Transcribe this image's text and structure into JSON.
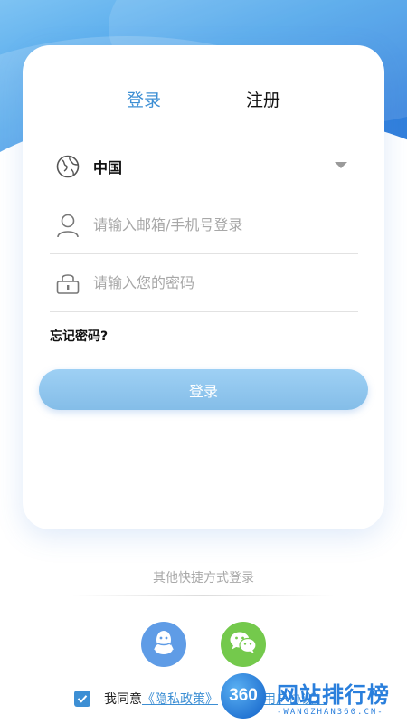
{
  "tabs": {
    "login": "登录",
    "register": "注册"
  },
  "country": {
    "value": "中国",
    "icon": "globe-icon"
  },
  "account": {
    "placeholder": "请输入邮箱/手机号登录",
    "icon": "user-icon"
  },
  "password": {
    "placeholder": "请输入您的密码",
    "icon": "lock-icon"
  },
  "forgot_label": "忘记密码?",
  "login_button": "登录",
  "other_login": {
    "title": "其他快捷方式登录",
    "providers": [
      "qq-icon",
      "wechat-icon"
    ]
  },
  "agreement": {
    "prefix": "我同意",
    "privacy_link": "《隐私政策》",
    "user_link": "《用户协议》",
    "checked": true
  },
  "watermark": {
    "logo": "360",
    "title": "网站排行榜",
    "subtitle": "-WANGZHAN360.CN-"
  },
  "colors": {
    "accent": "#3d8fd4",
    "button": "#8cc4ee",
    "qq": "#5f9ce6",
    "wechat": "#74c94c"
  }
}
